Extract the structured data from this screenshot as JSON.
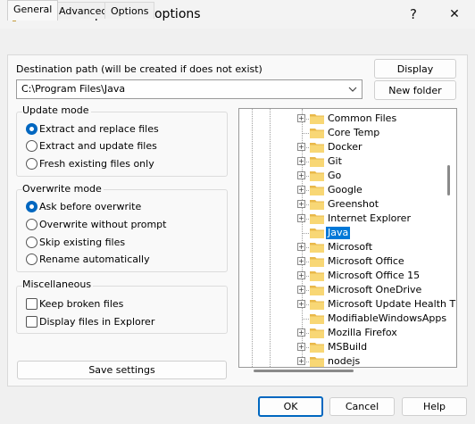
{
  "window": {
    "title": "Extraction path and options",
    "help_glyph": "?",
    "close_glyph": "✕"
  },
  "tabs": [
    {
      "label": "General",
      "active": true
    },
    {
      "label": "Advanced",
      "active": false
    },
    {
      "label": "Options",
      "active": false
    }
  ],
  "destination": {
    "label": "Destination path (will be created if does not exist)",
    "value": "C:\\Program Files\\Java",
    "display_button": "Display",
    "new_folder_button": "New folder"
  },
  "update_mode": {
    "title": "Update mode",
    "options": [
      {
        "label": "Extract and replace files",
        "selected": true
      },
      {
        "label": "Extract and update files",
        "selected": false
      },
      {
        "label": "Fresh existing files only",
        "selected": false
      }
    ]
  },
  "overwrite_mode": {
    "title": "Overwrite mode",
    "options": [
      {
        "label": "Ask before overwrite",
        "selected": true
      },
      {
        "label": "Overwrite without prompt",
        "selected": false
      },
      {
        "label": "Skip existing files",
        "selected": false
      },
      {
        "label": "Rename automatically",
        "selected": false
      }
    ]
  },
  "misc": {
    "title": "Miscellaneous",
    "options": [
      {
        "label": "Keep broken files",
        "checked": false
      },
      {
        "label": "Display files in Explorer",
        "checked": false
      }
    ]
  },
  "save_settings_button": "Save settings",
  "folder_tree": {
    "items": [
      {
        "name": "Common Files",
        "expandable": true,
        "selected": false
      },
      {
        "name": "Core Temp",
        "expandable": false,
        "selected": false
      },
      {
        "name": "Docker",
        "expandable": true,
        "selected": false
      },
      {
        "name": "Git",
        "expandable": true,
        "selected": false
      },
      {
        "name": "Go",
        "expandable": true,
        "selected": false
      },
      {
        "name": "Google",
        "expandable": true,
        "selected": false
      },
      {
        "name": "Greenshot",
        "expandable": true,
        "selected": false
      },
      {
        "name": "Internet Explorer",
        "expandable": true,
        "selected": false
      },
      {
        "name": "Java",
        "expandable": false,
        "selected": true
      },
      {
        "name": "Microsoft",
        "expandable": true,
        "selected": false
      },
      {
        "name": "Microsoft Office",
        "expandable": true,
        "selected": false
      },
      {
        "name": "Microsoft Office 15",
        "expandable": true,
        "selected": false
      },
      {
        "name": "Microsoft OneDrive",
        "expandable": true,
        "selected": false
      },
      {
        "name": "Microsoft Update Health T",
        "expandable": true,
        "selected": false
      },
      {
        "name": "ModifiableWindowsApps",
        "expandable": false,
        "selected": false
      },
      {
        "name": "Mozilla Firefox",
        "expandable": true,
        "selected": false
      },
      {
        "name": "MSBuild",
        "expandable": true,
        "selected": false
      },
      {
        "name": "nodejs",
        "expandable": true,
        "selected": false
      }
    ]
  },
  "footer": {
    "ok": "OK",
    "cancel": "Cancel",
    "help": "Help"
  },
  "colors": {
    "accent": "#0067c0",
    "selection": "#0078d7",
    "folder": "#f8d775"
  }
}
